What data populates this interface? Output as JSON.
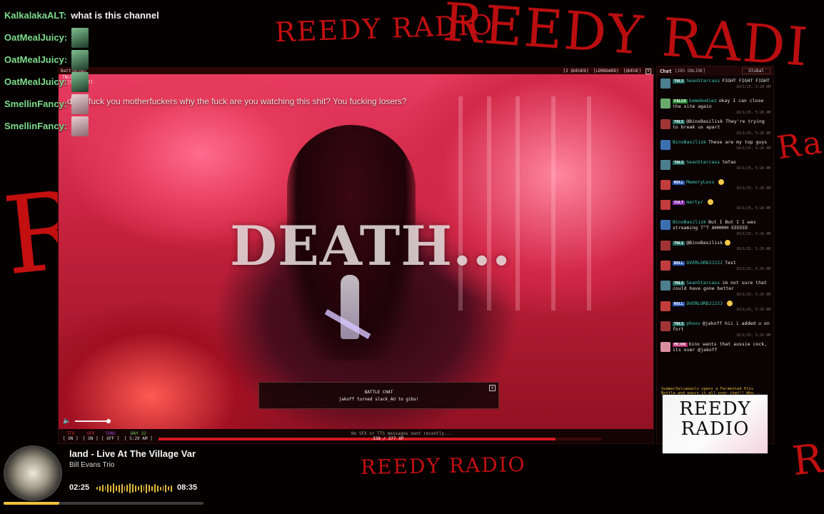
{
  "background_text": {
    "reedy_radio_1": "REEDY RADIO",
    "reedy_radio_2": "REEDY RADI",
    "rad": "Rad",
    "reedy_radio_bottom": "REEDY RADIO",
    "r_letter": "R"
  },
  "overlay_chat": [
    {
      "user": "KalkalakaALT:",
      "message": "what is this channel",
      "emote": ""
    },
    {
      "user": "OatMealJuicy:",
      "message": "",
      "emote": "green"
    },
    {
      "user": "OatMealJuicy:",
      "message": "",
      "emote": "green"
    },
    {
      "user": "OatMealJuicy:",
      "message": "",
      "emote": "green"
    },
    {
      "user": "SmellinFancy:",
      "message": "",
      "emote": "pale"
    },
    {
      "user": "SmellinFancy:",
      "message": "",
      "emote": "pale"
    }
  ],
  "video": {
    "window_title": "BattleChat",
    "queued": "[2 QUEUED]",
    "leaderboard": "[LDRBOARD]",
    "queue": "[QUEUE]",
    "close": "x",
    "meta_line1": "TNLS",
    "meta_line2": "K [STR] [LT]",
    "in_chat_text": "dude fuck you motherfuckers why the fuck are you watching this shit? You fucking losers?",
    "overlay_text": "DEATH...",
    "toast": {
      "title": "BATTLE CHAT",
      "message": "jakoff turned slack_AU to gibs!",
      "close": "x"
    },
    "bottom": {
      "tts_label": "TTS",
      "tts_state": "[ ON ]",
      "sfx_label": "SFX",
      "sfx_state": "[ ON ]",
      "tons_label": "TONS",
      "tons_state": "[ OFF ]",
      "day_label": "DAY 31",
      "day_time": "[ 5:29 AM ]",
      "no_sfx_text": "No SFX or TTS messages sent recently...",
      "xp_text": "338 / 377 XP",
      "xp_current": 338,
      "xp_max": 377
    },
    "volume_level": 0.85
  },
  "chat_panel": {
    "title": "Chat",
    "online": "[285 ONLINE]",
    "channel": "Global",
    "messages": [
      {
        "badge": "TNLS",
        "badge_color": "#1c6a60",
        "user": "SeanStarcass",
        "text": "FIGHT FIGHT FIGHT",
        "ts": "10/1/25, 5:28 AM",
        "avatar": "#4c7f8e"
      },
      {
        "badge": "FALCO",
        "badge_color": "#2d8a3a",
        "user": "Somebodiez",
        "text": "okay I can close the site again",
        "ts": "10/1/25, 5:28 AM",
        "avatar": "#6aa86b"
      },
      {
        "badge": "TNLS",
        "badge_color": "#1c6a60",
        "user": "",
        "text": "@BinxBasilisk They're trying to break us apart",
        "ts": "10/1/25, 5:28 AM",
        "avatar": "#a13434"
      },
      {
        "badge": "",
        "badge_color": "",
        "user": "BinxBasilisk",
        "text": "These are my top guys",
        "ts": "10/1/25, 5:28 AM",
        "avatar": "#3c6fb0"
      },
      {
        "badge": "TNLS",
        "badge_color": "#1c6a60",
        "user": "SeanStarcass",
        "text": "lmfao",
        "ts": "10/1/25, 5:28 AM",
        "avatar": "#4c7f8e"
      },
      {
        "badge": "ROLL",
        "badge_color": "#2b57b5",
        "user": "MemoryLoss",
        "text": "",
        "ts": "10/1/25, 5:28 AM",
        "avatar": "#c13c3c",
        "emoji": true
      },
      {
        "badge": "CULT",
        "badge_color": "#8a2cb5",
        "user": "martyr",
        "text": "",
        "ts": "10/1/25, 5:29 AM",
        "avatar": "#c13c3c",
        "emoji": true
      },
      {
        "badge": "",
        "badge_color": "",
        "user": "BinxBasilisk",
        "text": "But I But I I was streaming T^T AHHHHH EEEEEE",
        "ts": "10/1/25, 5:29 AM",
        "avatar": "#3c6fb0"
      },
      {
        "badge": "TNLS",
        "badge_color": "#1c6a60",
        "user": "",
        "text": "@BinxBasilisk",
        "ts": "10/1/25, 5:29 AM",
        "avatar": "#a13434",
        "emoji": true
      },
      {
        "badge": "ROLL",
        "badge_color": "#2b57b5",
        "user": "OVERLORDJJJJJ",
        "text": "Test",
        "ts": "10/1/25, 5:29 AM",
        "avatar": "#c13c3c"
      },
      {
        "badge": "TNLS",
        "badge_color": "#1c6a60",
        "user": "SeanStarcass",
        "text": "im not sure that could have gone better",
        "ts": "10/1/25, 5:29 AM",
        "avatar": "#4c7f8e"
      },
      {
        "badge": "ROLL",
        "badge_color": "#2b57b5",
        "user": "OVERLORDJJJJJ",
        "text": "",
        "ts": "10/1/25, 5:29 AM",
        "avatar": "#c13c3c",
        "emoji": true
      },
      {
        "badge": "TNLS",
        "badge_color": "#1c6a60",
        "user": "phoxv",
        "text": "@jakoff hii i added u on fort",
        "ts": "10/1/25, 5:29 AM",
        "avatar": "#a13434"
      },
      {
        "badge": "MEJOK",
        "badge_color": "#b52b6c",
        "user": "",
        "text": "binx wants that aussie cock, its over @jakoff",
        "ts": "",
        "avatar": "#d88fa0"
      }
    ],
    "system_msg": "SummerValcamails opens a Fermented Piss Bottle and pours it all over chat!! Who..."
  },
  "logo_card": {
    "line1": "REEDY",
    "line2": "RADIO"
  },
  "music": {
    "title": "land - Live At The Village Var",
    "artist": "Bill Evans Trio",
    "current_time": "02:25",
    "total_time": "08:35",
    "progress": 0.28,
    "accent": "#f0c23b"
  }
}
